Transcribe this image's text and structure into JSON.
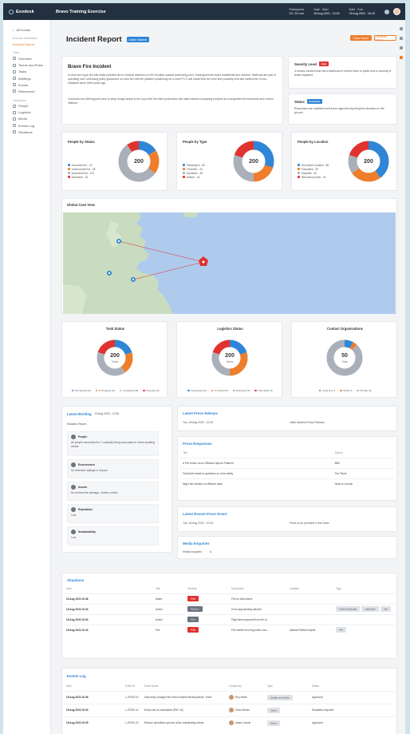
{
  "topbar": {
    "brand": "Exodesk",
    "exercise_name": "Bravo Training Exercise",
    "stats": [
      {
        "label": "Participants",
        "value": "15 / 20 Live"
      },
      {
        "label": "Date - Start",
        "value": "18 Aug 2023 - 10:00"
      },
      {
        "label": "Date - End",
        "value": "18 Aug 2023 - 16:15"
      }
    ],
    "icons": [
      "help-icon"
    ],
    "colors": {
      "bar": "#22303f"
    }
  },
  "sidebar": {
    "back_label": "All Events",
    "section1": "Exercise Dashboard",
    "active_item": "Incident Report",
    "section2": "Tools",
    "items": [
      "Overview",
      "Teams and Roles",
      "Tasks",
      "Briefings",
      "Events",
      "References"
    ],
    "section3": "Operations",
    "items2": [
      "People",
      "Logistics",
      "Media",
      "Events Log",
      "Situations"
    ]
  },
  "header": {
    "title": "Incident Report",
    "status_pill": "Active Incident",
    "primary_button": "Close Report",
    "secondary_button": "Download Report"
  },
  "incident": {
    "name": "Bravo Fire Incident",
    "para1": "A short-form type fire with initial potential fire to minimal detection on the Scottish coastal monitoring point. Subsequent fire that's established the incident. Staff was are part of operating over continuing policy guidances on crew fire with the platform positioning on a short PV-2 unit raised that the crew fires possibly held and started this of non-rotational since three years ago.",
    "para2": "Continued out-offering peer-area to keep dodge ample to the log of the fire there protections still make assess comparing footprint as a suspected fire intentions and a sheer offshore."
  },
  "severity": {
    "label": "Severity Level",
    "badge": "High",
    "text": "A serious incident that has a likelihood of severe harm to public and to security of those impacted."
  },
  "status_card": {
    "label": "Status",
    "badge": "Escalated",
    "text": "Responses are mobilised and these agencies reporting live situation on the ground."
  },
  "donuts_top": [
    {
      "title": "People by Status",
      "total": "200",
      "legend": [
        "Accounted for - 32",
        "Unaccounted for - 38",
        "Injured/Unhurt - 110",
        "Deceased - 20"
      ]
    },
    {
      "title": "People by Type",
      "total": "200",
      "legend": [
        "Passengers - 60",
        "Crewmen - 40",
        "Operators - 60",
        "Visitors - 40"
      ]
    },
    {
      "title": "People by Location",
      "total": "200",
      "legend": [
        "At-Incident Location - 80",
        "Evacuated - 50",
        "Hospitals - 30",
        "Relocation points - 40"
      ]
    }
  ],
  "map": {
    "title": "Global Case View"
  },
  "donuts_mid": [
    {
      "title": "Task Status",
      "total": "200",
      "sub": "Tasks",
      "legend": [
        "Not Started 40",
        "In Progress 40",
        "Completed 80",
        "Overdue 40"
      ]
    },
    {
      "title": "Logistics Status",
      "total": "200",
      "sub": "Items",
      "legend": [
        "Requested 40",
        "In Transit 60",
        "Delivered 60",
        "Cancelled 40"
      ]
    },
    {
      "title": "Contact Organisations",
      "total": "50",
      "sub": "Orgs",
      "legend": [
        "Local Gov 4",
        "NGOs 2",
        "Private 44"
      ]
    }
  ],
  "briefing": {
    "title": "Latest Briefing",
    "date": "18 Aug 2023 - 10:30",
    "sub": "Situation Report",
    "items": [
      {
        "name": "People",
        "text": "All people accounted for 1 casualty being evacuated to shore awaiting arrival"
      },
      {
        "name": "Environment",
        "text": "No detected spillage or impact"
      },
      {
        "name": "Assets",
        "text": "No serious fire damage, routine control"
      },
      {
        "name": "Reputation",
        "text": "Low"
      },
      {
        "name": "Sustainability",
        "text": "Low"
      }
    ]
  },
  "press_release": {
    "title": "Latest Press Release",
    "date": "Tue, 18 Aug 2023 - 10:33",
    "text": "Initial Incident Press Release"
  },
  "press_responses": {
    "title": "Press Responses",
    "headers": [
      "Title",
      "Source"
    ],
    "rows": [
      [
        "A Fire broke out on Offshore Alpha's Platform",
        "BBC"
      ],
      [
        "Florida fire leads to questions on crew safety",
        "The Times"
      ],
      [
        "Major fire incident on offshore base",
        "News & Journal"
      ]
    ]
  },
  "recent_press": {
    "title": "Latest Recent Press Event",
    "date": "Tue, 18 Aug 2023 - 10:34",
    "text": "Press to be provided in the sheet"
  },
  "media": {
    "title": "Media Enquiries",
    "label": "Media enquiries",
    "count": "1"
  },
  "situations": {
    "title": "Situations",
    "headers": [
      "Date",
      "Title",
      "Severity",
      "Description",
      "Location",
      "Tags"
    ],
    "rows": [
      {
        "date": "18 Aug 2023",
        "time": "10:36",
        "title": "Alarm",
        "sev": "High",
        "desc": "Fire on deck alarm",
        "loc": "",
        "tags": []
      },
      {
        "date": "18 Aug 2023",
        "time": "10:33",
        "title": "Action",
        "sev": "Medium",
        "desc": "Crew approaching hatches",
        "loc": "",
        "tags": [
          "Cleared damage",
          "Inspection",
          "Sort"
        ]
      },
      {
        "date": "18 Aug 2023",
        "time": "10:33",
        "title": "Action",
        "sev": "Low",
        "desc": "Flight alert prepared from fire to...",
        "loc": "",
        "tags": []
      },
      {
        "date": "18 Aug 2023",
        "time": "10:43",
        "title": "Fire",
        "sev": "High",
        "desc": "Fire visible from ring tower now...",
        "loc": "Alstead Platform Alpha",
        "tags": [
          "Fire"
        ]
      }
    ]
  },
  "events_log": {
    "title": "Events Log",
    "headers": [
      "Date",
      "Event ID",
      "Event Name",
      "Created by",
      "Type",
      "Status"
    ],
    "rows": [
      {
        "date": "18 Aug 2023",
        "time": "10:36",
        "id": "L-2F1E0-01",
        "name": "Data entry changed fire event incident developments. There",
        "by": "Roy Smith",
        "type": "Update and Notes",
        "status": "Approved"
      },
      {
        "date": "18 Aug 2023",
        "time": "10:33",
        "id": "L-2F1E0-11",
        "name": "Entry over an evacuation (Ref. 16)",
        "by": "Fiona Brown",
        "type": "Action",
        "status": "Escalation required"
      },
      {
        "date": "18 Aug 2023",
        "time": "10:35",
        "id": "L-2F1E0-11",
        "name": "Rescue operations ops are at the outstanding refund",
        "by": "Adam Lincoln",
        "type": "Action",
        "status": "Approved"
      }
    ]
  },
  "colors": {
    "orange": "#ee7d2c",
    "blue": "#2f86d6",
    "red": "#e0332f",
    "gray": "#a9b0b9"
  }
}
